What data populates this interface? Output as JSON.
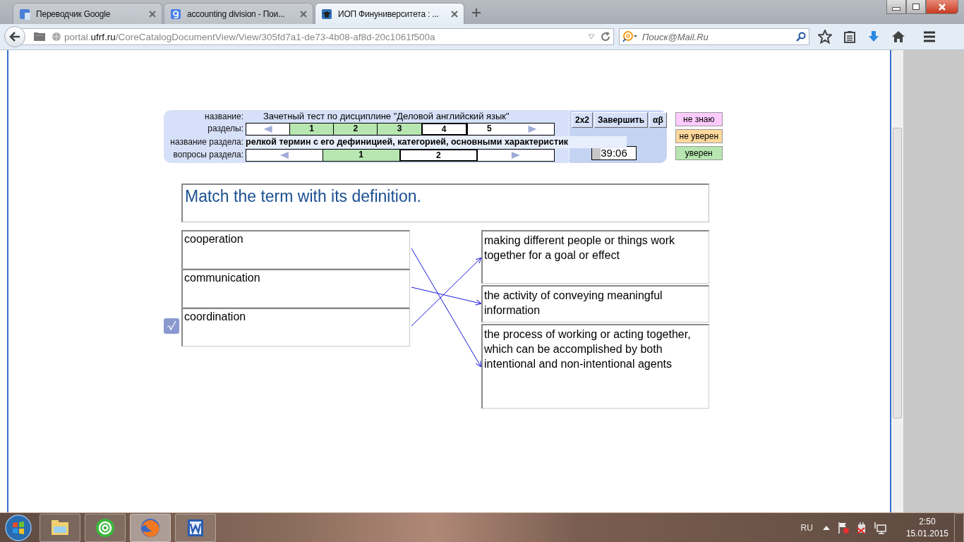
{
  "browser": {
    "tabs": [
      {
        "title": "Переводчик Google",
        "selected": false
      },
      {
        "title": "accounting division - Пои...",
        "selected": false
      },
      {
        "title": "ИОП Финуниверситета : ...",
        "selected": true
      }
    ],
    "url": {
      "host_pre": "portal.",
      "host": "ufrf.ru",
      "path": "/CoreCatalogDocumentView/View/305fd7a1-de73-4b08-af8d-20c1061f500a"
    },
    "search": {
      "placeholder": "Поиск@Mail.Ru"
    }
  },
  "test": {
    "labels": {
      "title": "название:",
      "sections": "разделы:",
      "section_title": "название раздела:",
      "questions": "вопросы раздела:"
    },
    "title": "Зачетный тест по дисциплине \"Деловой английский язык\"",
    "sections": [
      {
        "label": "1",
        "answered": true,
        "selected": false
      },
      {
        "label": "2",
        "answered": true,
        "selected": false
      },
      {
        "label": "3",
        "answered": true,
        "selected": false
      },
      {
        "label": "4",
        "answered": false,
        "selected": true
      },
      {
        "label": "5",
        "answered": false,
        "selected": false
      }
    ],
    "section_title": "релкой термин с его дефиницией, категорией, основными характеристик",
    "questions": [
      {
        "label": "1",
        "answered": true,
        "selected": false
      },
      {
        "label": "2",
        "answered": false,
        "selected": true
      }
    ],
    "buttons": [
      {
        "label": "2x2"
      },
      {
        "label": "Завершить"
      },
      {
        "label": "αβ"
      }
    ],
    "timer": {
      "reading": "39:06",
      "level": 0.2
    },
    "confidence": [
      {
        "label": "не знаю",
        "color": "#ffccff"
      },
      {
        "label": "не уверен",
        "color": "#ffd89c"
      },
      {
        "label": "уверен",
        "color": "#b7e6b1"
      }
    ]
  },
  "question": {
    "text": "Match the term with its definition.",
    "checked": true,
    "terms": [
      {
        "text": "cooperation",
        "links": [
          false,
          false,
          true
        ]
      },
      {
        "text": "communication",
        "links": [
          false,
          true,
          false
        ]
      },
      {
        "text": "coordination",
        "links": [
          true,
          false,
          false
        ]
      }
    ],
    "definitions": [
      {
        "text": "making different people or things work together for a goal or effect"
      },
      {
        "text": "the activity of conveying meaningful information"
      },
      {
        "text": "the process of working or acting together, which can be accomplished by both intentional and non-intentional agents"
      }
    ]
  },
  "taskbar": {
    "language": "RU",
    "time": "2:50",
    "date": "15.01.2015"
  }
}
